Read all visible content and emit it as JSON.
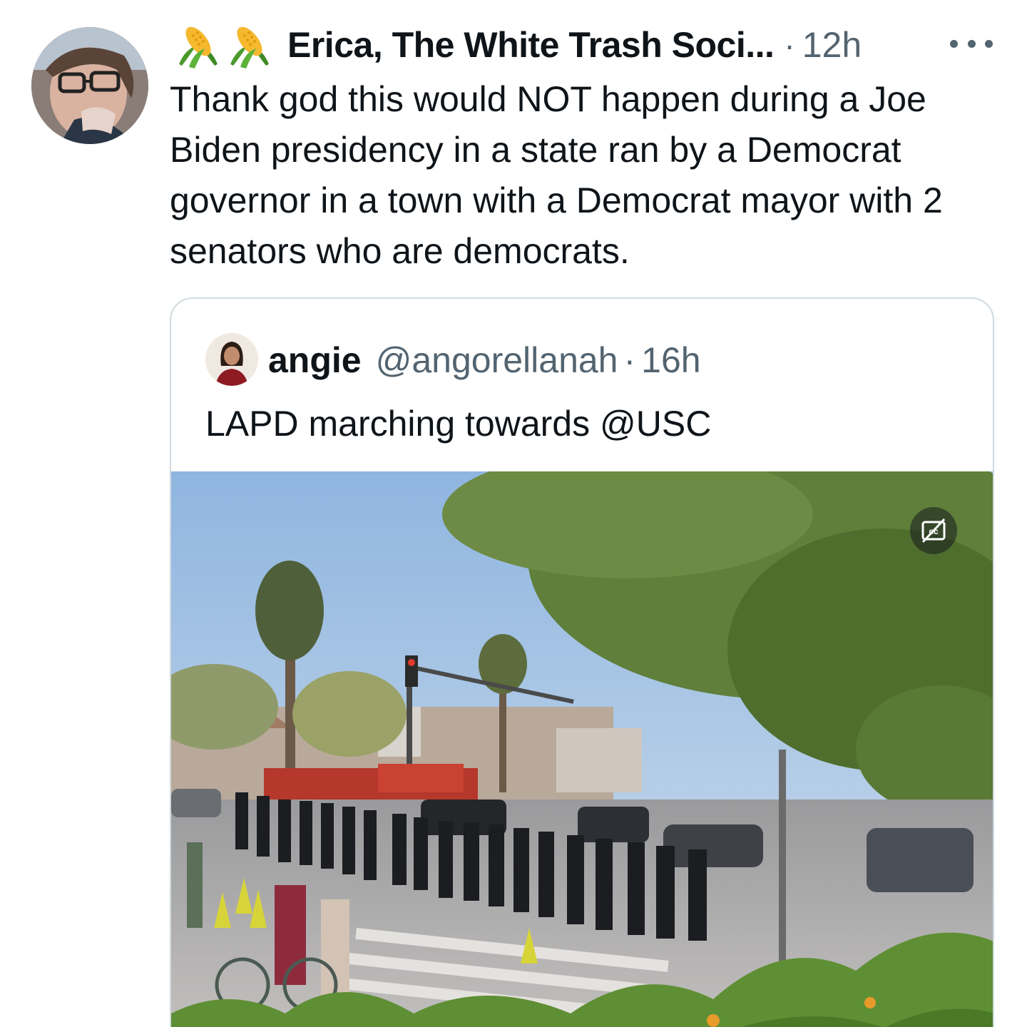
{
  "tweet": {
    "display_name": "Erica, The White Trash Soci...",
    "name_emojis": [
      "corn-icon",
      "corn-icon"
    ],
    "time": "12h",
    "separator": "·",
    "text": "Thank god this would NOT happen during a Joe Biden presidency in a state ran by a Democrat governor in a town with a Democrat mayor with 2 senators who are democrats.",
    "more_icon": "more-horizontal-icon"
  },
  "quoted_tweet": {
    "display_name": "angie",
    "handle": "@angorellanah",
    "separator": "·",
    "time": "16h",
    "text": "LAPD marching towards @USC",
    "media": {
      "type": "video",
      "caption_toggle_icon": "closed-captions-off-icon"
    }
  },
  "colors": {
    "text_primary": "#0f1419",
    "text_secondary": "#536471",
    "border": "#cfd9de"
  }
}
